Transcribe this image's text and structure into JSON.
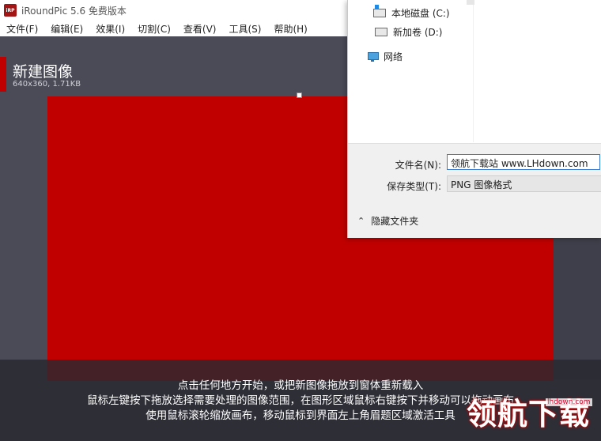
{
  "app": {
    "logo_text": "iRP",
    "title": "iRoundPic 5.6 免费版本"
  },
  "menu": {
    "items": [
      "文件(F)",
      "编辑(E)",
      "效果(I)",
      "切割(C)",
      "查看(V)",
      "工具(S)",
      "帮助(H)"
    ]
  },
  "document": {
    "title": "新建图像",
    "info": "640x360, 1.71KB",
    "canvas_color": "#c00000"
  },
  "hint": {
    "line1": "点击任何地方开始，或把新图像拖放到窗体重新载入",
    "line2": "鼠标左键按下拖放选择需要处理的图像范围，在图形区域鼠标右键按下并移动可以拖动画布",
    "line3": "使用鼠标滚轮缩放画布，移动鼠标到界面左上角眉题区域激活工具"
  },
  "dialog": {
    "tree": {
      "drive_c": "本地磁盘 (C:)",
      "drive_d": "新加卷 (D:)",
      "network": "网络"
    },
    "filename_label": "文件名(N):",
    "filename_value": "领航下载站  www.LHdown.com",
    "filetype_label": "保存类型(T):",
    "filetype_value": "PNG 图像格式",
    "hide_folders": "隐藏文件夹"
  },
  "watermark": {
    "text": "领航下载",
    "url": "lhdown.com"
  }
}
